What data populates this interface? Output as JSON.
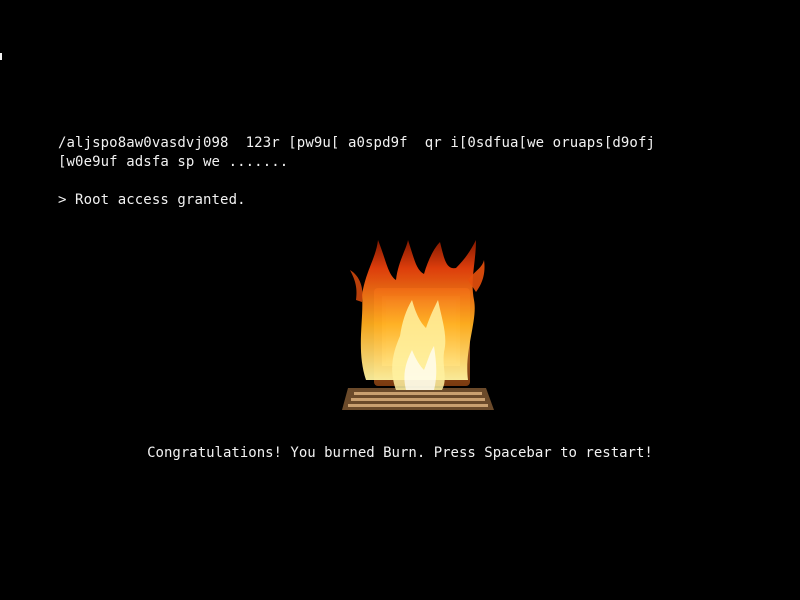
{
  "terminal": {
    "line1": "/aljspo8aw0vasdvj098  123r [pw9u[ a0spd9f  qr i[0sdfua[we oruaps[d9ofj",
    "line2": "[w0e9uf adsfa sp we .......",
    "line3": "> Root access granted."
  },
  "image": {
    "icon": "burning-computer-icon"
  },
  "message": {
    "text": "Congratulations! You burned Burn. Press Spacebar to restart!"
  },
  "colors": {
    "background": "#000000",
    "text": "#f2f2f2",
    "flame_outer": "#e8400c",
    "flame_mid": "#ff9a1a",
    "flame_core": "#fff3a0"
  }
}
